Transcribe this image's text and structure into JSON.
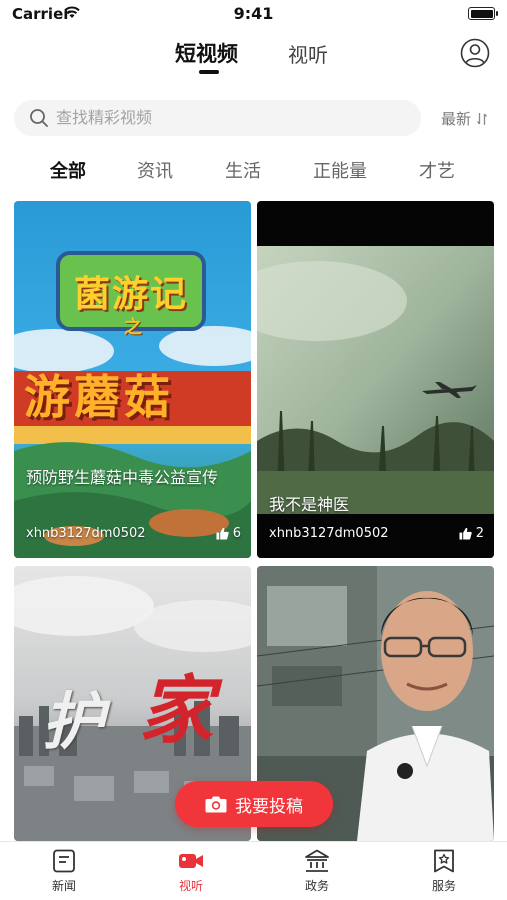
{
  "status_bar": {
    "carrier": "Carrier",
    "time": "9:41"
  },
  "header": {
    "tabs": [
      {
        "label": "短视频",
        "active": true
      },
      {
        "label": "视听",
        "active": false
      }
    ],
    "user_icon": "user-circle-icon"
  },
  "search": {
    "placeholder": "查找精彩视频",
    "sort_label": "最新"
  },
  "categories": [
    {
      "label": "全部",
      "active": true
    },
    {
      "label": "资讯"
    },
    {
      "label": "生活"
    },
    {
      "label": "正能量"
    },
    {
      "label": "才艺"
    }
  ],
  "videos": [
    {
      "title": "预防野生蘑菇中毒公益宣传",
      "author": "xhnb3127dm0502",
      "likes": "6",
      "thumb_text_1": "菌游记",
      "thumb_text_2": "之",
      "thumb_text_3": "游蘑菇"
    },
    {
      "title": "我不是神医",
      "author": "xhnb3127dm0502",
      "likes": "2"
    },
    {
      "title": "",
      "thumb_text_1": "护",
      "thumb_text_2": "家"
    },
    {
      "title": ""
    }
  ],
  "post_button": {
    "label": "我要投稿"
  },
  "tabbar": [
    {
      "label": "新闻",
      "icon": "news-icon",
      "active": false
    },
    {
      "label": "视听",
      "icon": "video-icon",
      "active": true
    },
    {
      "label": "政务",
      "icon": "government-icon",
      "active": false
    },
    {
      "label": "服务",
      "icon": "service-icon",
      "active": false
    }
  ],
  "colors": {
    "accent": "#e8333a",
    "post_button": "#f0353b"
  }
}
